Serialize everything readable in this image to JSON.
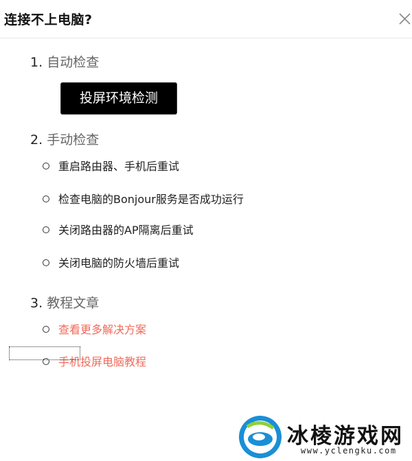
{
  "dialog": {
    "title": "连接不上电脑?",
    "close_icon": "close-icon"
  },
  "sections": [
    {
      "number": "1.",
      "title": "自动检查"
    },
    {
      "number": "2.",
      "title": "手动检查"
    },
    {
      "number": "3.",
      "title": "教程文章"
    }
  ],
  "auto_check": {
    "button_label": "投屏环境检测"
  },
  "manual_items": [
    "重启路由器、手机后重试",
    "检查电脑的Bonjour服务是否成功运行",
    "关闭路由器的AP隔离后重试",
    "关闭电脑的防火墙后重试"
  ],
  "tutorial_links": [
    "查看更多解决方案",
    "手机投屏电脑教程"
  ],
  "watermark": {
    "name": "冰棱游戏网",
    "url": "www.yclengku.com",
    "logo_icon": "ice-logo-icon"
  },
  "colors": {
    "link": "#f06a5a",
    "button_bg": "#000000",
    "section_title": "#666666"
  }
}
